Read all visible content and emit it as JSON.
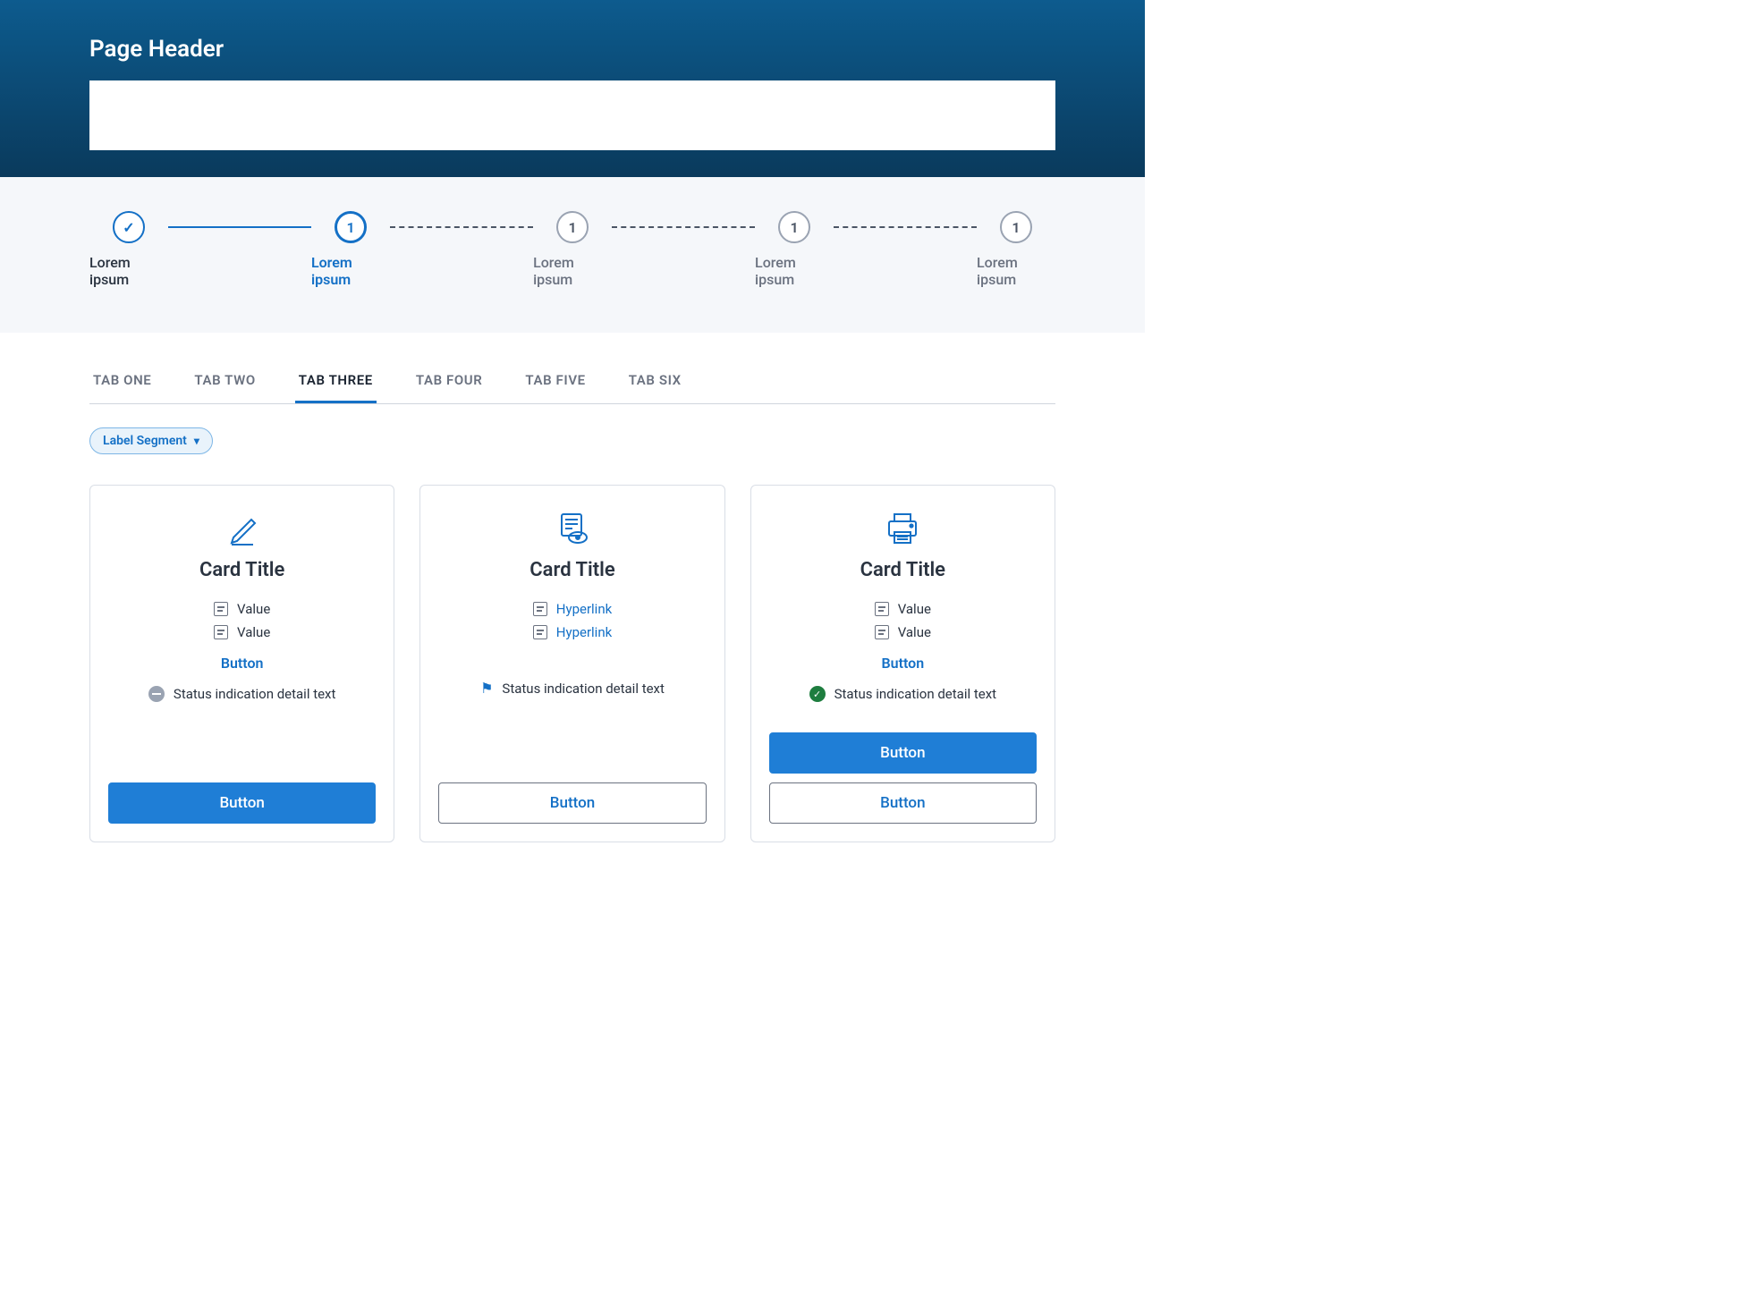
{
  "header": {
    "title": "Page Header"
  },
  "stepper": {
    "steps": [
      {
        "label": "Lorem ipsum",
        "state": "done",
        "indicator": "✓"
      },
      {
        "label": "Lorem ipsum",
        "state": "active",
        "indicator": "1"
      },
      {
        "label": "Lorem ipsum",
        "state": "future",
        "indicator": "1"
      },
      {
        "label": "Lorem ipsum",
        "state": "future",
        "indicator": "1"
      },
      {
        "label": "Lorem ipsum",
        "state": "future",
        "indicator": "1"
      }
    ]
  },
  "tabs": {
    "items": [
      {
        "label": "TAB ONE"
      },
      {
        "label": "TAB TWO"
      },
      {
        "label": "TAB THREE"
      },
      {
        "label": "TAB FOUR"
      },
      {
        "label": "TAB FIVE"
      },
      {
        "label": "TAB SIX"
      }
    ],
    "active_index": 2
  },
  "segment": {
    "label": "Label Segment"
  },
  "cards": [
    {
      "icon": "pencil-icon",
      "title": "Card Title",
      "rows": [
        {
          "type": "value",
          "text": "Value"
        },
        {
          "type": "value",
          "text": "Value"
        }
      ],
      "text_button": "Button",
      "status": {
        "kind": "neutral",
        "text": "Status indication detail text"
      },
      "buttons": [
        {
          "label": "Button",
          "kind": "primary"
        }
      ]
    },
    {
      "icon": "view-document-icon",
      "title": "Card Title",
      "rows": [
        {
          "type": "link",
          "text": "Hyperlink"
        },
        {
          "type": "link",
          "text": "Hyperlink"
        }
      ],
      "text_button": null,
      "status": {
        "kind": "flag",
        "text": "Status indication detail text"
      },
      "buttons": [
        {
          "label": "Button",
          "kind": "outline"
        }
      ]
    },
    {
      "icon": "printer-icon",
      "title": "Card Title",
      "rows": [
        {
          "type": "value",
          "text": "Value"
        },
        {
          "type": "value",
          "text": "Value"
        }
      ],
      "text_button": "Button",
      "status": {
        "kind": "ok",
        "text": "Status indication detail text"
      },
      "buttons": [
        {
          "label": "Button",
          "kind": "primary"
        },
        {
          "label": "Button",
          "kind": "outline"
        }
      ]
    }
  ],
  "colors": {
    "accent": "#1470c6"
  }
}
